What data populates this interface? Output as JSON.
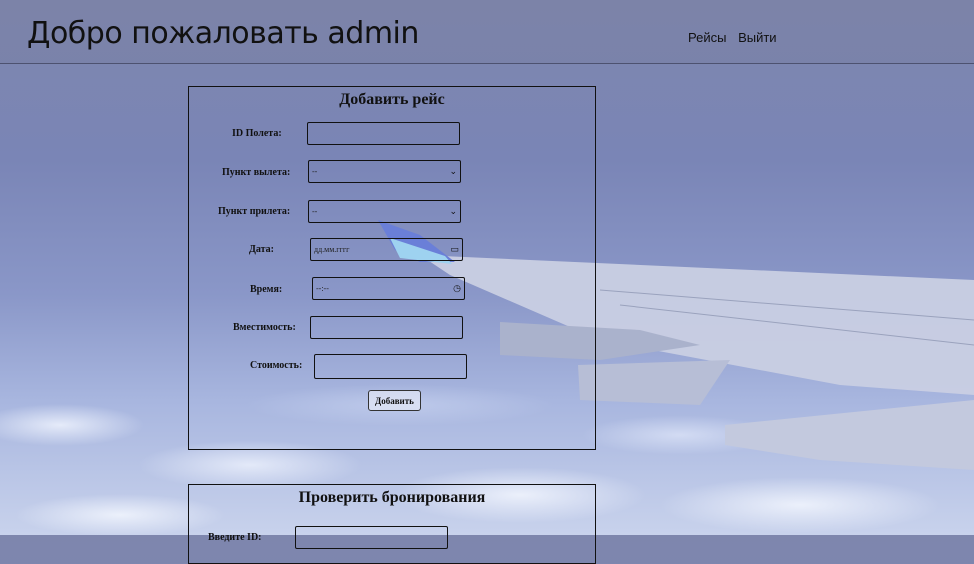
{
  "header": {
    "title": "Добро пожаловать admin",
    "nav": [
      {
        "label": "Рейсы"
      },
      {
        "label": "Выйти"
      }
    ]
  },
  "add_flight": {
    "title": "Добавить рейс",
    "fields": [
      {
        "label": "ID Полета:",
        "value": ""
      },
      {
        "label": "Пункт вылета:",
        "value": "--"
      },
      {
        "label": "Пункт прилета:",
        "value": "--"
      },
      {
        "label": "Дата:",
        "value": "дд.мм.гггг"
      },
      {
        "label": "Время:",
        "value": "--:--"
      },
      {
        "label": "Вместимость:",
        "value": ""
      },
      {
        "label": "Стоимость:",
        "value": ""
      }
    ],
    "submit_label": "Добавить"
  },
  "check_bookings": {
    "title": "Проверить бронирования",
    "fields": [
      {
        "label": "Введите ID:",
        "value": ""
      }
    ]
  },
  "icons": {
    "select_arrow": "chevron-down-icon",
    "date_picker": "calendar-icon",
    "time_picker": "clock-icon"
  }
}
